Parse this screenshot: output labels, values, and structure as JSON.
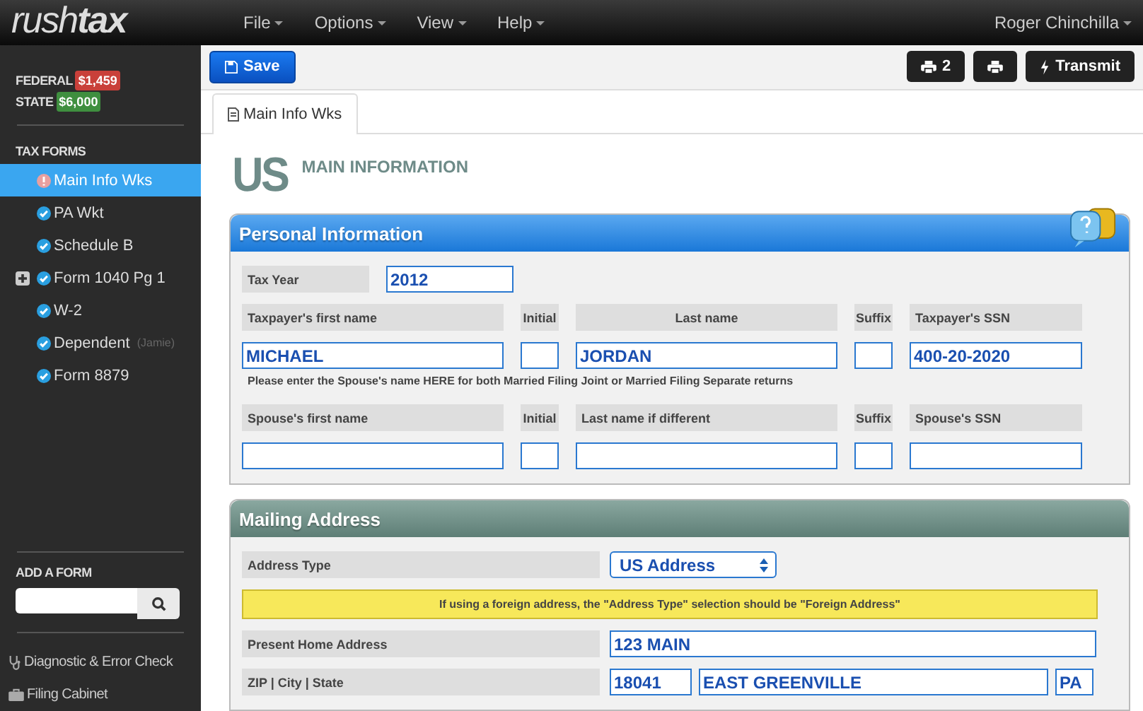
{
  "app": {
    "logo_light": "rush",
    "logo_bold": "tax"
  },
  "menu": [
    {
      "label": "File"
    },
    {
      "label": "Options"
    },
    {
      "label": "View"
    },
    {
      "label": "Help"
    }
  ],
  "user": "Roger Chinchilla",
  "sidebar": {
    "balances": [
      {
        "label": "FEDERAL",
        "amount": "$1,459",
        "color": "#c9403a"
      },
      {
        "label": "STATE",
        "amount": "$6,000",
        "color": "#3f8f3f"
      }
    ],
    "section_title": "TAX FORMS",
    "forms": [
      {
        "label": "Main Info Wks",
        "kind": "alert",
        "selected": true,
        "expandable": false
      },
      {
        "label": "PA Wkt",
        "kind": "done",
        "selected": false,
        "expandable": false
      },
      {
        "label": "Schedule B",
        "kind": "done",
        "selected": false,
        "expandable": false
      },
      {
        "label": "Form 1040 Pg 1",
        "kind": "done",
        "selected": false,
        "expandable": true
      },
      {
        "label": "W-2",
        "kind": "done",
        "selected": false,
        "expandable": false
      },
      {
        "label": "Dependent",
        "note": "(Jamie)",
        "kind": "done",
        "selected": false,
        "expandable": false
      },
      {
        "label": "Form 8879",
        "kind": "done",
        "selected": false,
        "expandable": false
      }
    ],
    "add_form_title": "ADD A FORM",
    "links": [
      {
        "label": "Diagnostic & Error Check",
        "kind": "stethoscope"
      },
      {
        "label": "Filing Cabinet",
        "kind": "briefcase"
      }
    ]
  },
  "toolbar": {
    "save": "Save",
    "print_count": "2",
    "transmit": "Transmit"
  },
  "tabs": [
    {
      "label": "Main Info Wks",
      "selected": true
    }
  ],
  "heading": {
    "country": "US",
    "title": "MAIN INFORMATION"
  },
  "personal": {
    "title": "Personal Information",
    "tax_year": {
      "label": "Tax Year",
      "value": "2012"
    },
    "taxpayer": [
      {
        "label": "Taxpayer's first name",
        "value": "MICHAEL"
      },
      {
        "label": "Initial"
      },
      {
        "label": "Last name",
        "value": "JORDAN"
      },
      {
        "label": "Suffix"
      },
      {
        "label": "Taxpayer's SSN",
        "value": "400-20-2020"
      }
    ],
    "note": "Please enter the Spouse's name HERE for both Married Filing Joint or Married Filing Separate returns",
    "spouse": [
      {
        "label": "Spouse's first name"
      },
      {
        "label": "Initial"
      },
      {
        "label": "Last name if different"
      },
      {
        "label": "Suffix"
      },
      {
        "label": "Spouse's SSN"
      }
    ]
  },
  "mailing": {
    "title": "Mailing Address",
    "address_type": {
      "label": "Address Type",
      "value": "US Address"
    },
    "notice": "If using a foreign address, the \"Address Type\" selection should be \"Foreign Address\"",
    "home": {
      "label": "Present Home Address",
      "value": "123 MAIN"
    },
    "zip_city_state": {
      "label": "ZIP | City | State",
      "values": [
        "18041",
        "EAST GREENVILLE",
        "PA"
      ]
    }
  }
}
